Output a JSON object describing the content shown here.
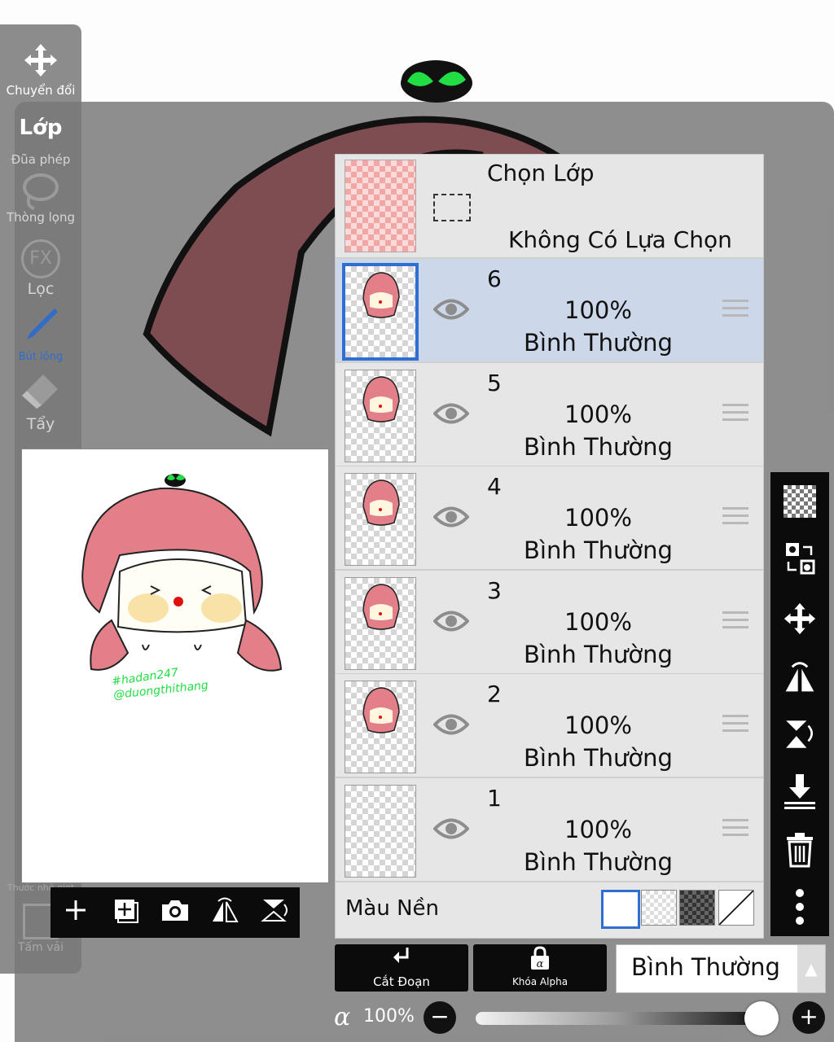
{
  "toolbar": {
    "items": [
      {
        "label": "Chuyển đổi",
        "icon": "move-arrows-icon"
      },
      {
        "label": "Lớp",
        "icon": "layer-icon"
      },
      {
        "label": "Đũa phép",
        "icon": "magic-wand-icon"
      },
      {
        "label": "Thòng lọng",
        "icon": "lasso-icon"
      },
      {
        "label": "Lọc",
        "icon": "fx-icon",
        "glyph": "FX"
      },
      {
        "label": "Bút lông",
        "icon": "brush-icon"
      },
      {
        "label": "Tẩy",
        "icon": "eraser-icon"
      },
      {
        "label": "Thước nhỏ giọt",
        "icon": "dropper-icon"
      },
      {
        "label": "Tấm vải",
        "icon": "canvas-icon"
      }
    ]
  },
  "preview": {
    "watermark_line1": "#hadan247",
    "watermark_line2": "@duongthithang",
    "buttons": [
      "+",
      "⊞",
      "camera",
      "flip-h",
      "flip-v"
    ]
  },
  "layers_panel": {
    "selection": {
      "title": "Chọn Lớp",
      "subtitle": "Không Có Lựa Chọn"
    },
    "layers": [
      {
        "number": "6",
        "opacity": "100%",
        "mode": "Bình Thường",
        "selected": true
      },
      {
        "number": "5",
        "opacity": "100%",
        "mode": "Bình Thường",
        "selected": false
      },
      {
        "number": "4",
        "opacity": "100%",
        "mode": "Bình Thường",
        "selected": false
      },
      {
        "number": "3",
        "opacity": "100%",
        "mode": "Bình Thường",
        "selected": false
      },
      {
        "number": "2",
        "opacity": "100%",
        "mode": "Bình Thường",
        "selected": false
      },
      {
        "number": "1",
        "opacity": "100%",
        "mode": "Bình Thường",
        "selected": false
      }
    ],
    "background_label": "Màu Nền"
  },
  "bottom": {
    "clip_label": "Cắt Đoạn",
    "alpha_lock_label": "Khóa Alpha",
    "alpha_lock_glyph": "α",
    "blend_mode": "Bình Thường",
    "alpha_symbol": "α",
    "opacity_value": "100%",
    "minus": "−",
    "plus": "+"
  },
  "colors": {
    "accent": "#2e6fd1",
    "selected_row": "#ccd8ea",
    "leaf": "#22dd44",
    "hair": "#d9707a"
  }
}
